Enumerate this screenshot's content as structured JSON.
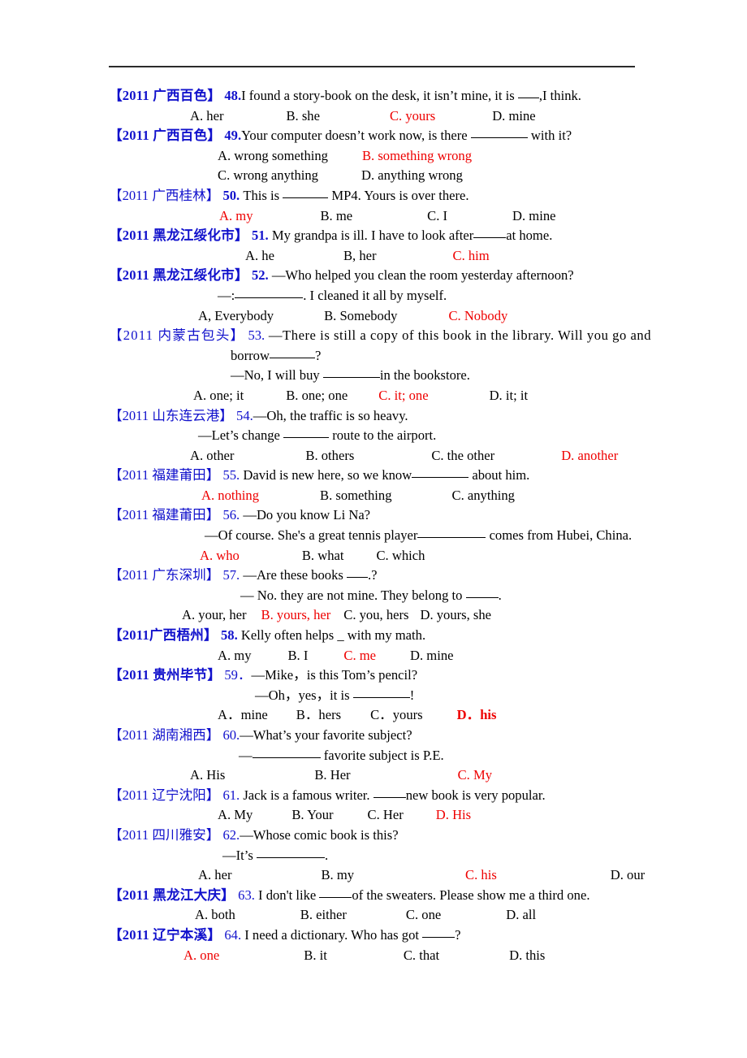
{
  "document": {
    "rule_color": "#2b2b2b",
    "tag_color": "#1111cc",
    "answer_color": "#ee0000",
    "text_color": "#000000"
  },
  "questions": [
    {
      "tag": "【2011 广西百色】",
      "number": "48.",
      "lines": [
        "I found a story-book on the desk, it isn’t mine, it is ",
        ",I think."
      ],
      "options": [
        {
          "label": "A. her",
          "correct": false
        },
        {
          "label": "B. she",
          "correct": false
        },
        {
          "label": "C. yours",
          "correct": true
        },
        {
          "label": "D. mine",
          "correct": false
        }
      ]
    },
    {
      "tag": "【2011 广西百色】",
      "number": "49.",
      "lines": [
        "Your computer doesn’t work now, is there ",
        " with it?"
      ],
      "options": [
        {
          "label": "A. wrong something",
          "correct": false
        },
        {
          "label": "B. something wrong",
          "correct": true
        },
        {
          "label": "C. wrong anything",
          "correct": false
        },
        {
          "label": "D. anything wrong",
          "correct": false
        }
      ]
    },
    {
      "tag": "【2011 广西桂林】",
      "number": "50.",
      "lines": [
        " This is ",
        " MP4. Yours is over there."
      ],
      "options": [
        {
          "label": "A. my",
          "correct": true
        },
        {
          "label": "B. me",
          "correct": false
        },
        {
          "label": "C. I",
          "correct": false
        },
        {
          "label": "D. mine",
          "correct": false
        }
      ]
    },
    {
      "tag": "【2011 黑龙江绥化市】",
      "number": "51.",
      "lines": [
        " My grandpa is ill. I have to look after",
        "at home."
      ],
      "options": [
        {
          "label": "A. he",
          "correct": false
        },
        {
          "label": "B, her",
          "correct": false
        },
        {
          "label": "C. him",
          "correct": true
        }
      ]
    },
    {
      "tag": "【2011 黑龙江绥化市】",
      "number": "52.",
      "lines": [
        " —Who helped you clean the room yesterday afternoon?",
        "—:",
        ". I cleaned it all by myself."
      ],
      "options": [
        {
          "label": "A, Everybody",
          "correct": false
        },
        {
          "label": "B. Somebody",
          "correct": false
        },
        {
          "label": "C. Nobody",
          "correct": true
        }
      ]
    },
    {
      "tag": "【2011 内蒙古包头】",
      "number": "53.",
      "lines": [
        " —There is still a copy of this book in the library. Will you go and",
        "borrow",
        "?",
        "—No, I will buy ",
        "in the bookstore."
      ],
      "options": [
        {
          "label": "A. one; it",
          "correct": false
        },
        {
          "label": "B. one; one",
          "correct": false
        },
        {
          "label": "C. it; one",
          "correct": true
        },
        {
          "label": "D. it; it",
          "correct": false
        }
      ]
    },
    {
      "tag": "【2011 山东连云港】",
      "number": "54.",
      "lines": [
        "—Oh, the traffic is so heavy.",
        "—Let’s change ",
        " route to the airport."
      ],
      "options": [
        {
          "label": "A. other",
          "correct": false
        },
        {
          "label": "B. others",
          "correct": false
        },
        {
          "label": "C. the other",
          "correct": false
        },
        {
          "label": "D. another",
          "correct": true
        }
      ]
    },
    {
      "tag": "【2011 福建莆田】",
      "number": "55.",
      "lines": [
        " David is new here, so we know",
        " about him."
      ],
      "options": [
        {
          "label": "A. nothing",
          "correct": true
        },
        {
          "label": "B. something",
          "correct": false
        },
        {
          "label": "C. anything",
          "correct": false
        }
      ]
    },
    {
      "tag": "【2011 福建莆田】",
      "number": "56.",
      "lines": [
        " —Do you know Li Na?",
        "—Of course. She's a great tennis player",
        " comes from Hubei, China."
      ],
      "options": [
        {
          "label": "A. who",
          "correct": true
        },
        {
          "label": "B. what",
          "correct": false
        },
        {
          "label": "C. which",
          "correct": false
        }
      ]
    },
    {
      "tag": "【2011 广东深圳】",
      "number": "57.",
      "lines": [
        " —Are these books ",
        ".?",
        "— No. they are not mine. They belong to ",
        "."
      ],
      "options": [
        {
          "label": "A. your, her",
          "correct": false
        },
        {
          "label": "B. yours, her",
          "correct": true
        },
        {
          "label": "C. you, hers",
          "correct": false
        },
        {
          "label": "D. yours, she",
          "correct": false
        }
      ]
    },
    {
      "tag": "【2011广西梧州】",
      "number": "58.",
      "lines": [
        " Kelly often helps _ with my math."
      ],
      "options": [
        {
          "label": "A. my",
          "correct": false
        },
        {
          "label": "B. I",
          "correct": false
        },
        {
          "label": "C. me",
          "correct": true
        },
        {
          "label": "D. mine",
          "correct": false
        }
      ]
    },
    {
      "tag": "【2011 贵州毕节】",
      "number": "59．",
      "lines": [
        "—Mike，is this Tom’s pencil?",
        "—Oh，yes，it is ",
        "!"
      ],
      "options": [
        {
          "label": "A．mine",
          "correct": false
        },
        {
          "label": "B．hers",
          "correct": false
        },
        {
          "label": "C．yours",
          "correct": false
        },
        {
          "label": "D．his",
          "correct": true
        }
      ]
    },
    {
      "tag": "【2011 湖南湘西】",
      "number": "60.",
      "lines": [
        "—What’s your favorite subject?",
        "—",
        " favorite subject is P.E."
      ],
      "options": [
        {
          "label": "A. His",
          "correct": false
        },
        {
          "label": "B. Her",
          "correct": false
        },
        {
          "label": "C. My",
          "correct": true
        }
      ]
    },
    {
      "tag": "【2011 辽宁沈阳】",
      "number": "61.",
      "lines": [
        " Jack is a famous writer. ",
        "new book is very popular."
      ],
      "options": [
        {
          "label": "A. My",
          "correct": false
        },
        {
          "label": "B. Your",
          "correct": false
        },
        {
          "label": "C. Her",
          "correct": false
        },
        {
          "label": "D. His",
          "correct": true
        }
      ]
    },
    {
      "tag": "【2011 四川雅安】",
      "number": "62.",
      "lines": [
        "—Whose comic book is this?",
        "—It’s ",
        "."
      ],
      "options": [
        {
          "label": "A. her",
          "correct": false
        },
        {
          "label": "B. my",
          "correct": false
        },
        {
          "label": "C. his",
          "correct": true
        },
        {
          "label": "D. our",
          "correct": false
        }
      ]
    },
    {
      "tag": "【2011 黑龙江大庆】",
      "number": "63.",
      "lines": [
        " I don't like ",
        "of the sweaters. Please show me a third one."
      ],
      "options": [
        {
          "label": "A. both",
          "correct": false
        },
        {
          "label": "B. either",
          "correct": false
        },
        {
          "label": "C. one",
          "correct": false
        },
        {
          "label": "D. all",
          "correct": false
        }
      ]
    },
    {
      "tag": "【2011 辽宁本溪】",
      "number": "64.",
      "lines": [
        " I need a dictionary. Who has got ",
        "?"
      ],
      "options": [
        {
          "label": "A. one",
          "correct": true
        },
        {
          "label": "B. it",
          "correct": false
        },
        {
          "label": "C. that",
          "correct": false
        },
        {
          "label": "D. this",
          "correct": false
        }
      ]
    }
  ]
}
